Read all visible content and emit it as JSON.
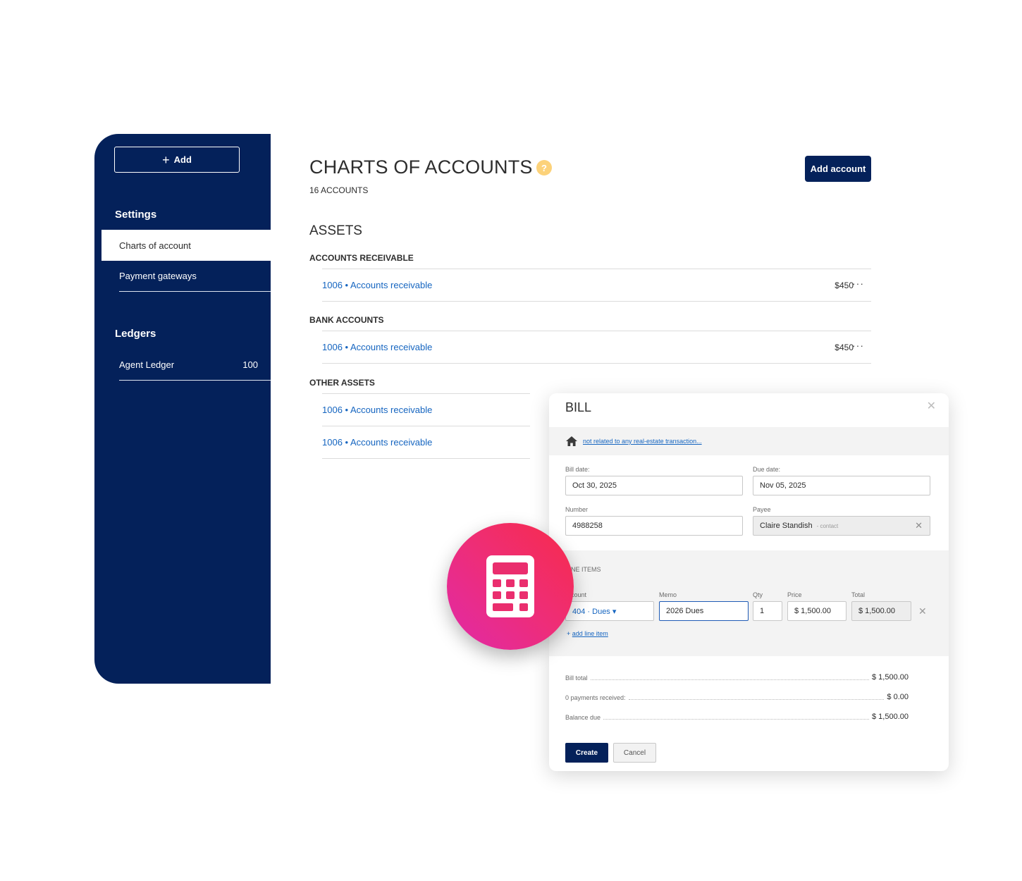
{
  "sidebar": {
    "add_label": "Add",
    "settings_heading": "Settings",
    "settings_items": [
      {
        "label": "Charts of account"
      },
      {
        "label": "Payment gateways"
      }
    ],
    "ledgers_heading": "Ledgers",
    "ledger_items": [
      {
        "label": "Agent Ledger",
        "count": "100"
      }
    ]
  },
  "main": {
    "title": "CHARTS OF ACCOUNTS",
    "help_glyph": "?",
    "count_label": "16 ACCOUNTS",
    "add_account_label": "Add account",
    "section_title": "ASSETS",
    "groups": [
      {
        "title": "ACCOUNTS RECEIVABLE",
        "rows": [
          {
            "name": "1006 • Accounts receivable",
            "amount": "$450"
          }
        ]
      },
      {
        "title": "BANK ACCOUNTS",
        "rows": [
          {
            "name": "1006 • Accounts receivable",
            "amount": "$450"
          }
        ]
      },
      {
        "title": "OTHER ASSETS",
        "rows": [
          {
            "name": "1006 • Accounts receivable"
          },
          {
            "name": "1006 • Accounts receivable"
          }
        ]
      }
    ]
  },
  "bill": {
    "title": "BILL",
    "transaction_link": "not related to any real-estate transaction...",
    "bill_date_label": "Bill date:",
    "bill_date": "Oct 30, 2025",
    "due_date_label": "Due date:",
    "due_date": "Nov 05, 2025",
    "number_label": "Number",
    "number": "4988258",
    "payee_label": "Payee",
    "payee": "Claire Standish",
    "payee_type": "- contact",
    "line_items_title": "NE ITEMS",
    "col_account": "count",
    "col_memo": "Memo",
    "col_qty": "Qty",
    "col_price": "Price",
    "col_total": "Total",
    "line": {
      "account": "404 · Dues ▾",
      "memo": "2026 Dues",
      "qty": "1",
      "price": "$ 1,500.00",
      "total": "$ 1,500.00"
    },
    "add_line_label": "add line item",
    "bill_total_label": "Bill total",
    "bill_total": "$ 1,500.00",
    "payments_label": "0 payments received:",
    "payments": "$ 0.00",
    "balance_label": "Balance due",
    "balance": "$ 1,500.00",
    "create_label": "Create",
    "cancel_label": "Cancel"
  },
  "colors": {
    "navy": "#04215a",
    "link": "#1565c0",
    "accent_pink": "#ee2d78",
    "help_yellow": "#fcd27a"
  },
  "icons": [
    "plus-icon",
    "help-icon",
    "more-icon",
    "close-icon",
    "home-icon",
    "calculator-icon"
  ]
}
